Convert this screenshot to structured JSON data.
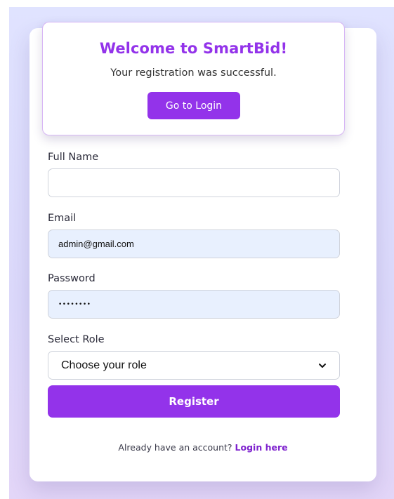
{
  "popup": {
    "title": "Welcome to SmartBid!",
    "message": "Your registration was successful.",
    "button_label": "Go to Login"
  },
  "form": {
    "full_name": {
      "label": "Full Name",
      "value": ""
    },
    "email": {
      "label": "Email",
      "value": "admin@gmail.com"
    },
    "password": {
      "label": "Password",
      "masked_value": "••••••••"
    },
    "role": {
      "label": "Select Role",
      "selected": "Choose your role"
    },
    "register_label": "Register"
  },
  "footer": {
    "prompt": "Already have an account? ",
    "link_label": "Login here"
  },
  "colors": {
    "accent": "#9333ea",
    "autofill_bg": "#e8f0fe",
    "page_bg_top": "#e0e3ff",
    "page_bg_bottom": "#e3d6f8"
  }
}
